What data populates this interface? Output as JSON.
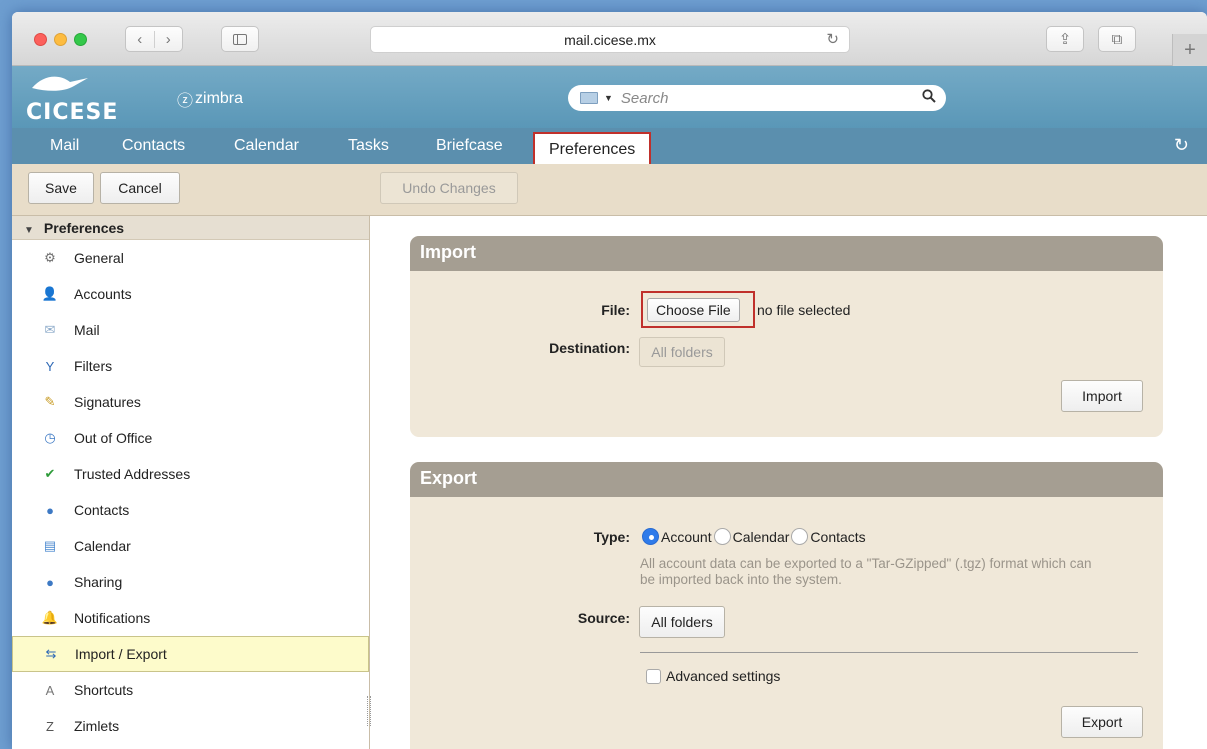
{
  "browser": {
    "url": "mail.cicese.mx",
    "back_glyph": "‹",
    "forward_glyph": "›",
    "reload_glyph": "↻",
    "share_glyph": "⇪",
    "tabs_glyph": "⧉",
    "newtab_glyph": "+"
  },
  "brand": {
    "logo_text": "CICESE",
    "product": "zimbra",
    "product_icon": "ⓩ"
  },
  "search": {
    "placeholder": "Search",
    "icon": "search-icon"
  },
  "app_tabs": [
    {
      "label": "Mail"
    },
    {
      "label": "Contacts"
    },
    {
      "label": "Calendar"
    },
    {
      "label": "Tasks"
    },
    {
      "label": "Briefcase"
    },
    {
      "label": "Preferences",
      "active": true
    }
  ],
  "toolbar": {
    "save_label": "Save",
    "cancel_label": "Cancel",
    "undo_label": "Undo Changes"
  },
  "sidebar": {
    "header": "Preferences",
    "items": [
      {
        "label": "General",
        "icon": "gear-icon",
        "glyph": "⚙",
        "color": "#6f6f6f"
      },
      {
        "label": "Accounts",
        "icon": "accounts-icon",
        "glyph": "👤",
        "color": "#3d79c4"
      },
      {
        "label": "Mail",
        "icon": "envelope-icon",
        "glyph": "✉",
        "color": "#8aa8c8"
      },
      {
        "label": "Filters",
        "icon": "filter-icon",
        "glyph": "Y",
        "color": "#2d68b5"
      },
      {
        "label": "Signatures",
        "icon": "signature-icon",
        "glyph": "✎",
        "color": "#c79a22"
      },
      {
        "label": "Out of Office",
        "icon": "out-of-office-icon",
        "glyph": "◷",
        "color": "#3d79c4"
      },
      {
        "label": "Trusted Addresses",
        "icon": "shield-icon",
        "glyph": "✔",
        "color": "#2e9b3a"
      },
      {
        "label": "Contacts",
        "icon": "contact-icon",
        "glyph": "●",
        "color": "#3d79c4"
      },
      {
        "label": "Calendar",
        "icon": "calendar-icon",
        "glyph": "▤",
        "color": "#4c8ad0"
      },
      {
        "label": "Sharing",
        "icon": "sharing-icon",
        "glyph": "●",
        "color": "#3d79c4"
      },
      {
        "label": "Notifications",
        "icon": "bell-icon",
        "glyph": "🔔",
        "color": "#e0a82a"
      },
      {
        "label": "Import / Export",
        "icon": "import-export-icon",
        "glyph": "⇆",
        "color": "#2d68b5",
        "selected": true
      },
      {
        "label": "Shortcuts",
        "icon": "keyboard-icon",
        "glyph": "A",
        "color": "#777777"
      },
      {
        "label": "Zimlets",
        "icon": "zimlet-icon",
        "glyph": "Z",
        "color": "#555555"
      }
    ]
  },
  "import": {
    "title": "Import",
    "file_label": "File:",
    "choose_file_label": "Choose File",
    "file_status": "no file selected",
    "destination_label": "Destination:",
    "destination_value": "All folders",
    "button_label": "Import"
  },
  "export": {
    "title": "Export",
    "type_label": "Type:",
    "types": [
      {
        "label": "Account",
        "checked": true
      },
      {
        "label": "Calendar",
        "checked": false
      },
      {
        "label": "Contacts",
        "checked": false
      }
    ],
    "hint": "All account data can be exported to a \"Tar-GZipped\" (.tgz) format which can be imported back into the system.",
    "source_label": "Source:",
    "source_value": "All folders",
    "advanced_label": "Advanced settings",
    "button_label": "Export"
  },
  "colors": {
    "accent_red": "#c0302b",
    "header_blue": "#5b8fae",
    "panel_bg": "#f0e8d9",
    "panel_title": "#a59e92",
    "selected_row": "#fdfbcb",
    "radio_blue": "#2f7bea"
  }
}
